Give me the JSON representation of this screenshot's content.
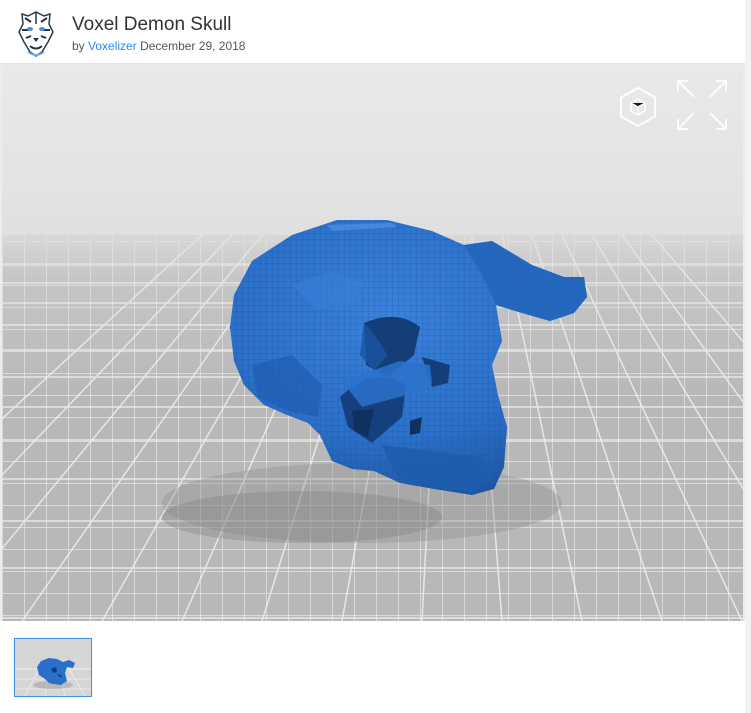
{
  "header": {
    "title": "Voxel Demon Skull",
    "by_prefix": "by",
    "author": "Voxelizer",
    "date": "December 29, 2018",
    "avatar_icon": "tiger-avatar-icon"
  },
  "viewer": {
    "model_color": "#2a6fc9",
    "controls": [
      {
        "name": "3d-view-icon"
      },
      {
        "name": "fullscreen-icon"
      }
    ]
  },
  "thumbnails": {
    "items": [
      {
        "name": "skull-thumbnail",
        "selected": true
      }
    ],
    "selected_border": "#3d8fe0"
  }
}
